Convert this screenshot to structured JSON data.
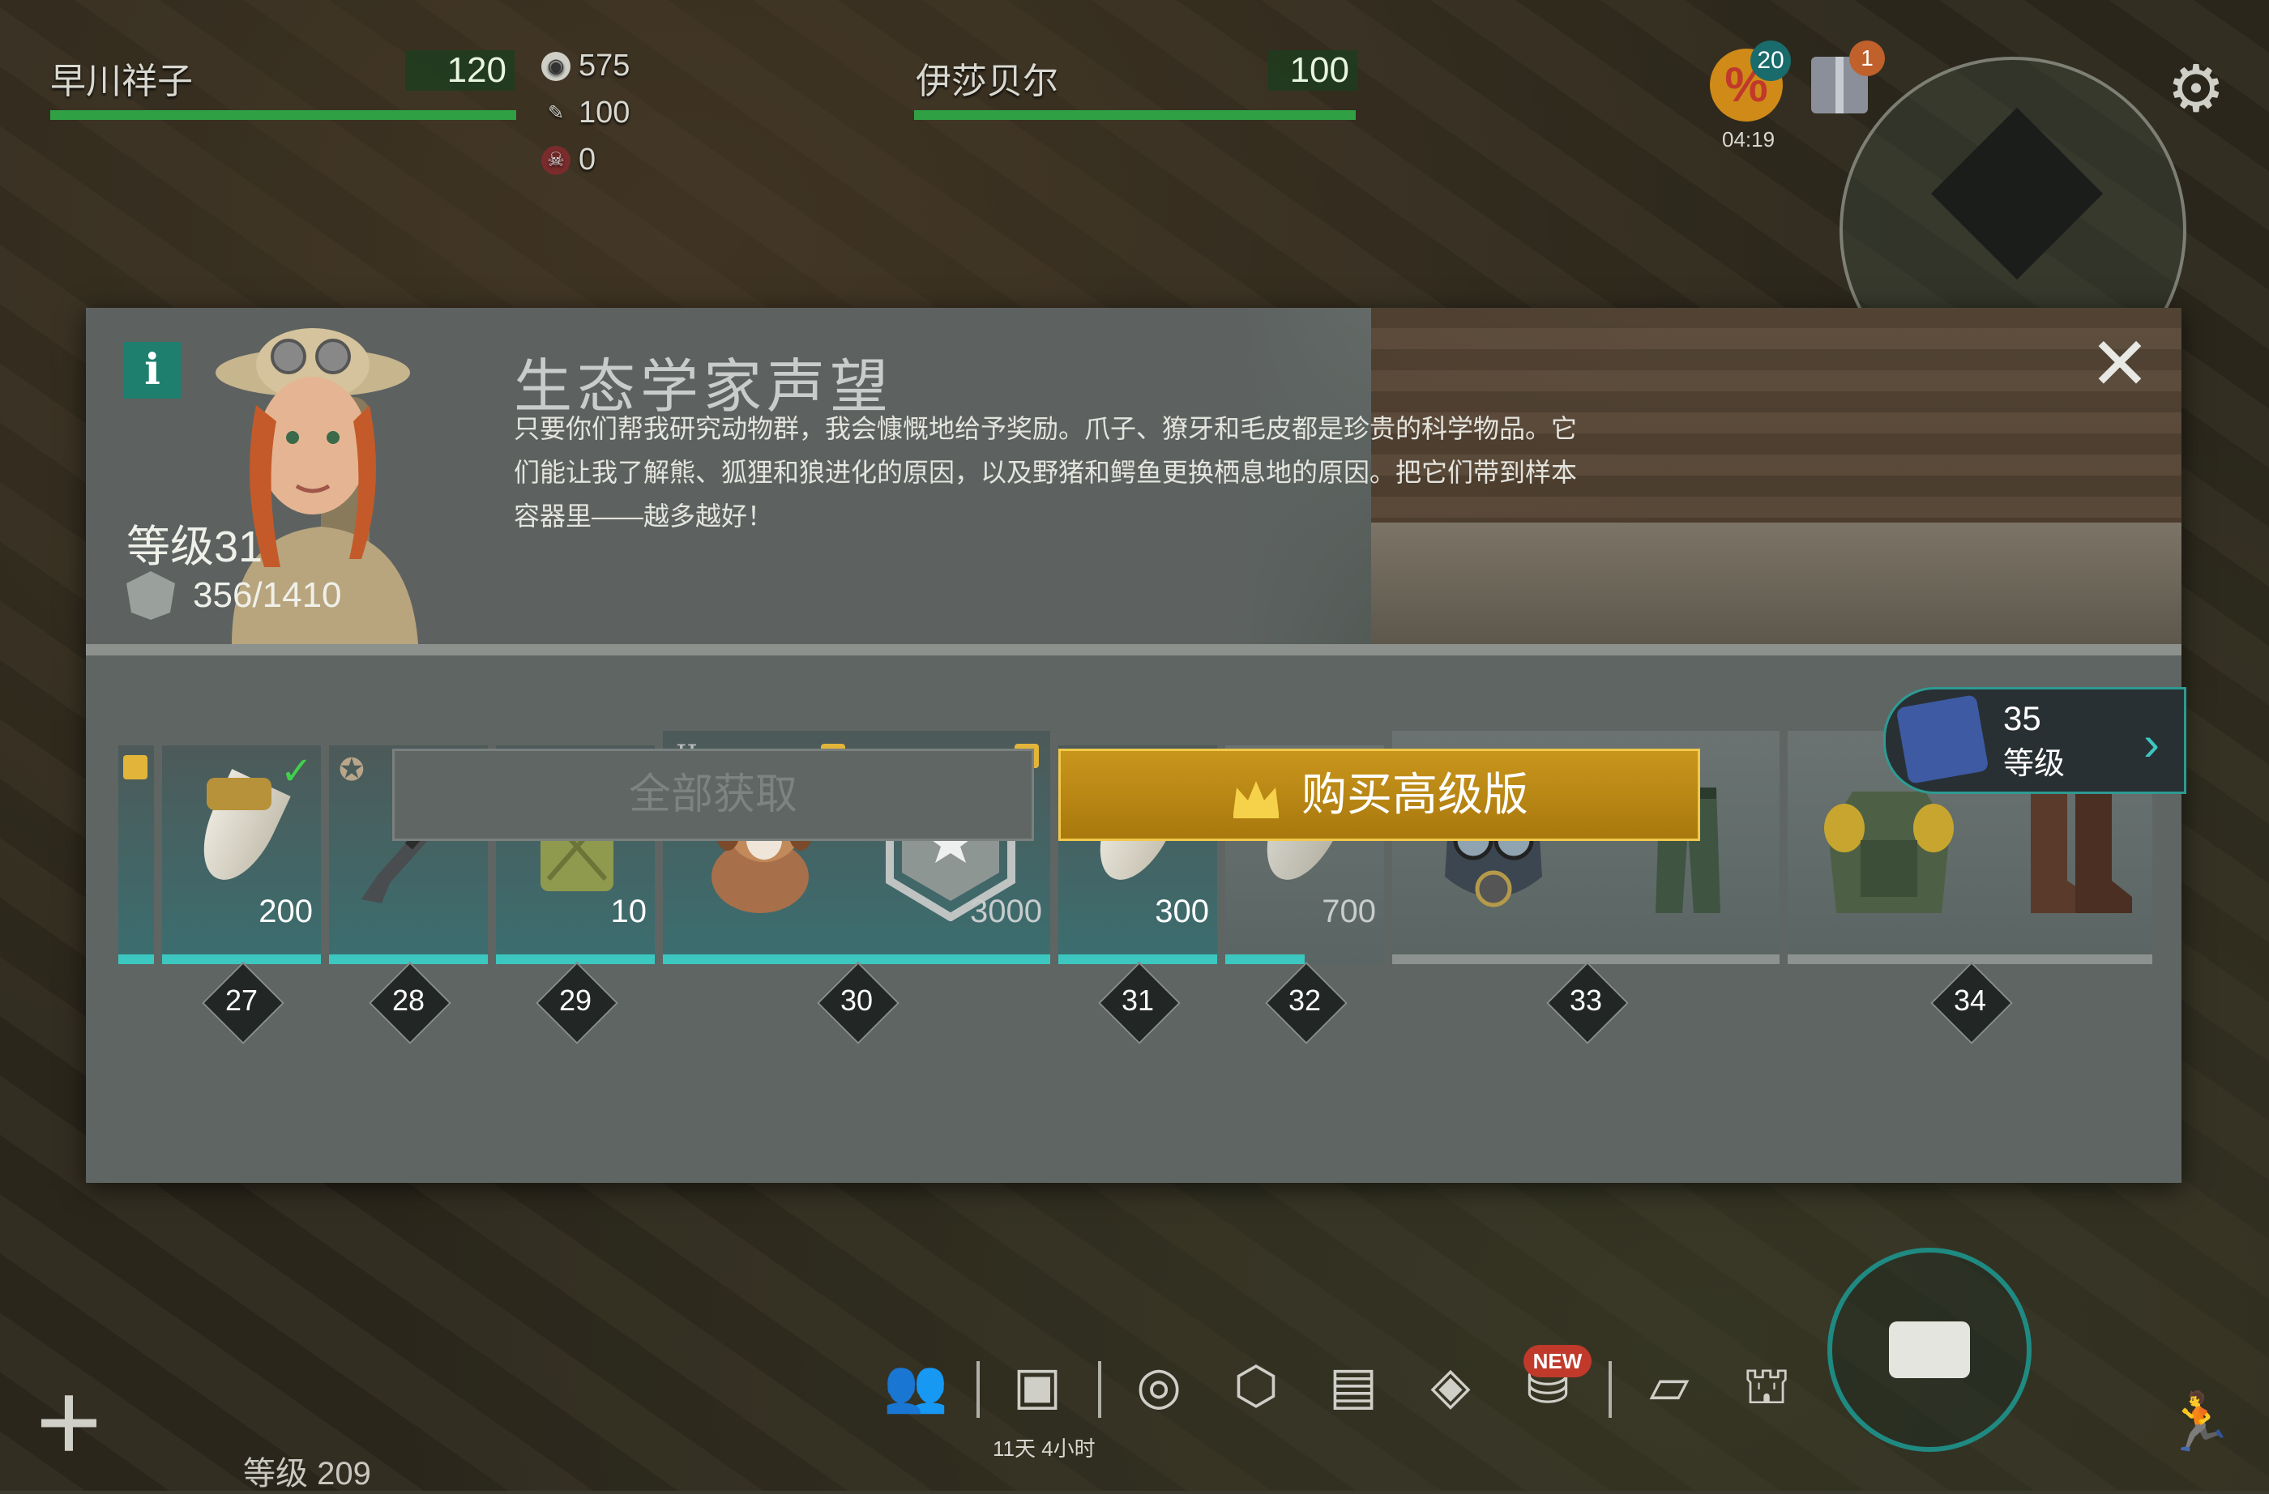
{
  "hud": {
    "player1": {
      "name": "早川祥子",
      "hp": "120"
    },
    "player2": {
      "name": "伊莎贝尔",
      "hp": "100"
    },
    "stats": [
      {
        "icon": "currency-icon",
        "value": "575"
      },
      {
        "icon": "feather-icon",
        "value": "100"
      },
      {
        "icon": "skull-icon",
        "value": "0"
      }
    ],
    "promo": {
      "badge": "20",
      "timer": "04:19",
      "symbol": "%"
    },
    "gift": {
      "badge": "1"
    }
  },
  "panel": {
    "info_label": "i",
    "title": "生态学家声望",
    "description": "只要你们帮我研究动物群，我会慷慨地给予奖励。爪子、獠牙和毛皮都是珍贵的科学物品。它们能让我了解熊、狐狸和狼进化的原因，以及野猪和鳄鱼更换栖息地的原因。把它们带到样本容器里——越多越好！",
    "level_label": "等级31",
    "xp": "356/1410",
    "close": "✕"
  },
  "track": {
    "levels": [
      {
        "level": "27",
        "amount": "200",
        "item": "fang",
        "claimed": true
      },
      {
        "level": "28",
        "amount": "",
        "item": "rifle",
        "locked": true
      },
      {
        "level": "29",
        "amount": "10",
        "item": "jerrycan",
        "claimed": true
      },
      {
        "level": "30",
        "amount": "3000",
        "item": "dog-and-emblem",
        "locked": true,
        "tier": "II"
      },
      {
        "level": "31",
        "amount": "300",
        "item": "fang",
        "claimed": true
      },
      {
        "level": "32",
        "amount": "700",
        "item": "fang",
        "locked": true
      },
      {
        "level": "33",
        "amount": "",
        "item": "gasmask-and-pants"
      },
      {
        "level": "34",
        "amount": "",
        "item": "vest-and-boots"
      }
    ],
    "premium_preview": {
      "level": "35",
      "level_text": "等级",
      "arrow": "›"
    }
  },
  "buttons": {
    "claim_all": "全部获取",
    "buy_premium": "购买高级版"
  },
  "bottom": {
    "level": "等级 209",
    "timer": "11天 4小时",
    "new_badge": "NEW"
  },
  "colors": {
    "accent": "#3cc7c0",
    "gold": "#c9961c",
    "hp_green": "#2fa043"
  }
}
